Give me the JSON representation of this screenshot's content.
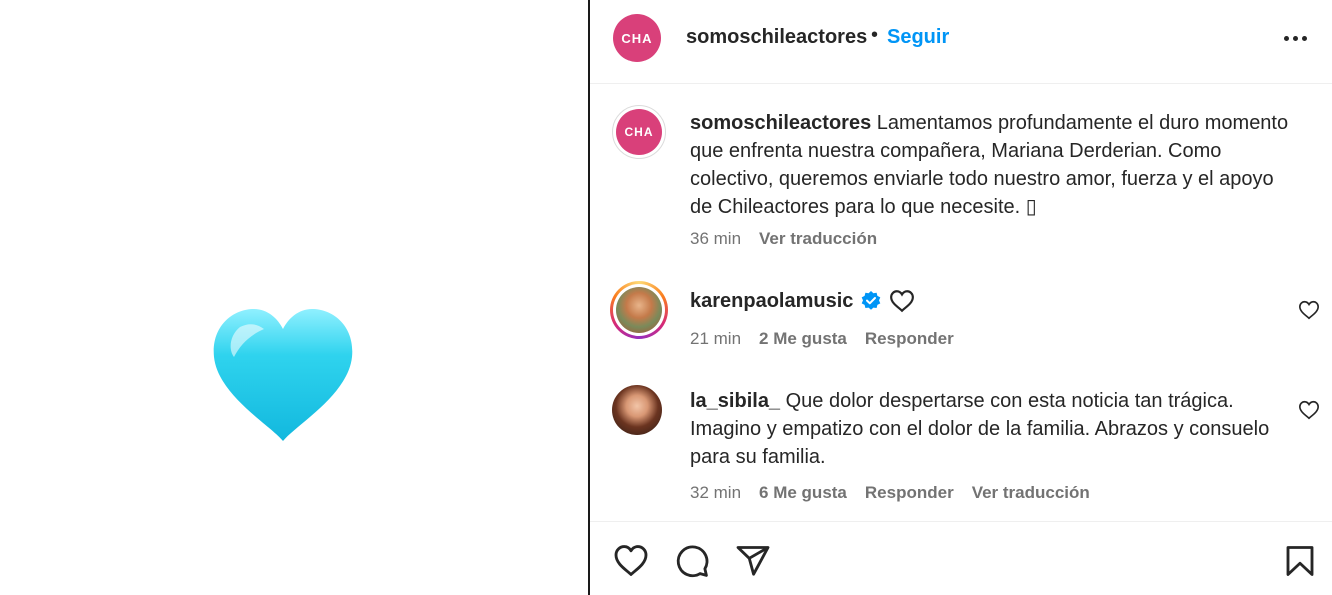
{
  "post": {
    "emoji": "light-blue-heart-emoji"
  },
  "header": {
    "avatar_text": "CHA",
    "username": "somoschileactores",
    "dot": "•",
    "follow_label": "Seguir"
  },
  "caption": {
    "avatar_text": "CHA",
    "username": "somoschileactores",
    "text": "Lamentamos profundamente el duro momento que enfrenta nuestra compañera, Mariana Derderian. Como colectivo, queremos enviarle todo nuestro amor, fuerza y el apoyo de Chileactores para lo que necesite. ▯",
    "time": "36 min",
    "translate": "Ver traducción"
  },
  "comments": [
    {
      "username": "karenpaolamusic",
      "verified": true,
      "text": "",
      "time": "21 min",
      "likes": "2 Me gusta",
      "reply": "Responder"
    },
    {
      "username": "la_sibila_",
      "verified": false,
      "text": "Que dolor despertarse con esta noticia tan trágica. Imagino y empatizo con el dolor de la familia. Abrazos y consuelo para su familia.",
      "time": "32 min",
      "likes": "6 Me gusta",
      "reply": "Responder",
      "translate": "Ver traducción"
    }
  ],
  "colors": {
    "accent": "#0095f6",
    "brand_avatar": "#d9407a",
    "heart_emoji": "#2fd3ee",
    "verified": "#0095f6"
  },
  "icons": {
    "like": "heart-outline-icon",
    "comment": "speech-bubble-icon",
    "share": "paper-plane-icon",
    "save": "bookmark-icon",
    "more": "three-dots-icon"
  }
}
